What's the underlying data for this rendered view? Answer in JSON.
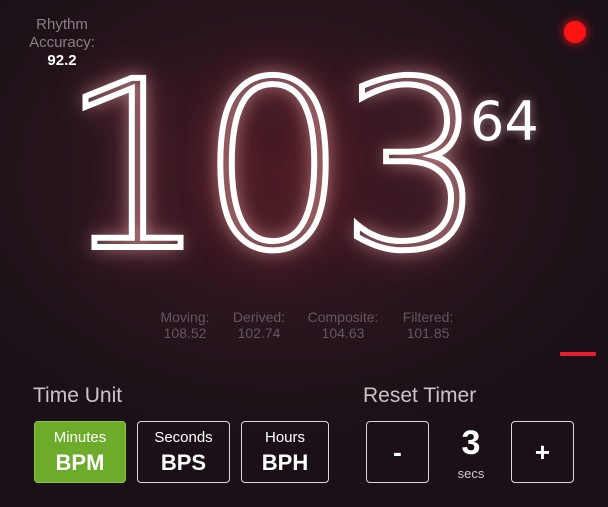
{
  "accuracy": {
    "label": "Rhythm Accuracy:",
    "value": "92.2"
  },
  "bpm": {
    "main": "103",
    "secondary": "64"
  },
  "stats": [
    {
      "label": "Moving:",
      "value": "108.52"
    },
    {
      "label": "Derived:",
      "value": "102.74"
    },
    {
      "label": "Composite:",
      "value": "104.63"
    },
    {
      "label": "Filtered:",
      "value": "101.85"
    }
  ],
  "time_unit": {
    "title": "Time Unit",
    "buttons": [
      {
        "small": "Minutes",
        "big": "BPM",
        "selected": true
      },
      {
        "small": "Seconds",
        "big": "BPS",
        "selected": false
      },
      {
        "small": "Hours",
        "big": "BPH",
        "selected": false
      }
    ]
  },
  "reset_timer": {
    "title": "Reset Timer",
    "minus_label": "-",
    "plus_label": "+",
    "value": "3",
    "unit": "secs"
  },
  "colors": {
    "background": "#1e1219",
    "accent_green": "#6cac2a",
    "record_red": "#ff1414",
    "indicator_red": "#e3202a"
  },
  "icons": {
    "record": "record-dot-icon"
  }
}
